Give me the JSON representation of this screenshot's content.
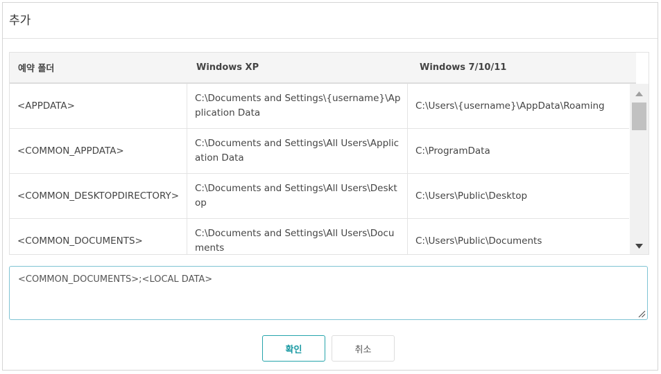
{
  "dialog": {
    "title": "추가"
  },
  "table": {
    "headers": [
      "예약 폴더",
      "Windows XP",
      "Windows 7/10/11"
    ],
    "rows": [
      [
        "<APPDATA>",
        "C:\\Documents and Settings\\{username}\\Application Data",
        "C:\\Users\\{username}\\AppData\\Roaming"
      ],
      [
        "<COMMON_APPDATA>",
        "C:\\Documents and Settings\\All Users\\Application Data",
        "C:\\ProgramData"
      ],
      [
        "<COMMON_DESKTOPDIRECTORY>",
        "C:\\Documents and Settings\\All Users\\Desktop",
        "C:\\Users\\Public\\Desktop"
      ],
      [
        "<COMMON_DOCUMENTS>",
        "C:\\Documents and Settings\\All Users\\Documents",
        "C:\\Users\\Public\\Documents"
      ]
    ]
  },
  "scrollbar": {
    "up_icon": "triangle-up-icon",
    "down_icon": "triangle-down-icon"
  },
  "input": {
    "value": "<COMMON_DOCUMENTS>;<LOCAL DATA>"
  },
  "buttons": {
    "ok_label": "확인",
    "cancel_label": "취소"
  },
  "colors": {
    "accent": "#25a4ab",
    "input_border": "#7ec3d3",
    "header_bg": "#f5f5f5"
  }
}
